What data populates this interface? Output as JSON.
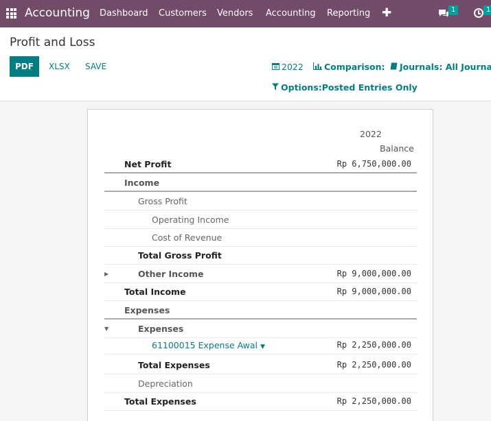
{
  "navbar": {
    "app_name": "Accounting",
    "menu": [
      "Dashboard",
      "Customers",
      "Vendors",
      "Accounting",
      "Reporting"
    ],
    "chat_count": "1",
    "activity_count": "1"
  },
  "control_panel": {
    "title": "Profit and Loss",
    "buttons": {
      "pdf": "PDF",
      "xlsx": "XLSX",
      "save": "SAVE"
    },
    "filters": {
      "date": "2022",
      "comparison": "Comparison:",
      "journals": "Journals: All Journals",
      "options": "Options:Posted Entries Only"
    }
  },
  "report": {
    "column_year": "2022",
    "column_label": "Balance",
    "rows": [
      {
        "label": "Net Profit",
        "value": "Rp 6,750,000.00"
      },
      {
        "label": "Income",
        "value": ""
      },
      {
        "label": "Gross Profit",
        "value": ""
      },
      {
        "label": "Operating Income",
        "value": ""
      },
      {
        "label": "Cost of Revenue",
        "value": ""
      },
      {
        "label": "Total Gross Profit",
        "value": ""
      },
      {
        "label": "Other Income",
        "value": "Rp 9,000,000.00"
      },
      {
        "label": "Total Income",
        "value": "Rp 9,000,000.00"
      },
      {
        "label": "Expenses",
        "value": ""
      },
      {
        "label": "Expenses",
        "value": ""
      },
      {
        "label": "61100015 Expense Awal",
        "value": "Rp 2,250,000.00"
      },
      {
        "label": "Total Expenses",
        "value": "Rp 2,250,000.00"
      },
      {
        "label": "Depreciation",
        "value": ""
      },
      {
        "label": "Total Expenses",
        "value": "Rp 2,250,000.00"
      }
    ]
  },
  "colors": {
    "navbar": "#714b67",
    "primary": "#017e84",
    "badge": "#00a09d"
  }
}
